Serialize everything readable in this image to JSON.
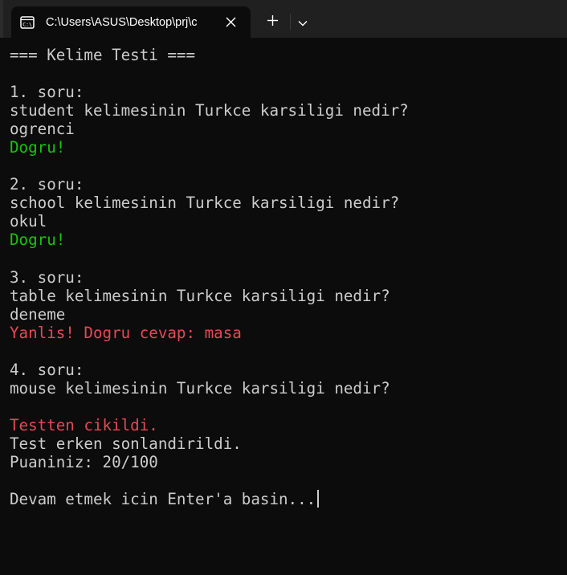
{
  "window": {
    "tab_title": "C:\\Users\\ASUS\\Desktop\\prj\\c",
    "icons": {
      "tab": "terminal-icon",
      "close": "close-icon",
      "new_tab": "plus-icon",
      "dropdown": "chevron-down-icon"
    }
  },
  "colors": {
    "background": "#0c0c0c",
    "titlebar": "#202020",
    "text": "#cccccc",
    "success": "#16c60c",
    "error": "#e74856"
  },
  "terminal": {
    "header": "=== Kelime Testi ===",
    "questions": [
      {
        "label": "1. soru:",
        "prompt": "student kelimesinin Turkce karsiligi nedir?",
        "answer": "ogrenci",
        "result": "Dogru!"
      },
      {
        "label": "2. soru:",
        "prompt": "school kelimesinin Turkce karsiligi nedir?",
        "answer": "okul",
        "result": "Dogru!"
      },
      {
        "label": "3. soru:",
        "prompt": "table kelimesinin Turkce karsiligi nedir?",
        "answer": "deneme",
        "result": "Yanlis! Dogru cevap: masa"
      },
      {
        "label": "4. soru:",
        "prompt": "mouse kelimesinin Turkce karsiligi nedir?"
      }
    ],
    "exit_message": "Testten cikildi.",
    "early_end": "Test erken sonlandirildi.",
    "score": "Puaniniz: 20/100",
    "continue_prompt": "Devam etmek icin Enter'a basin..."
  }
}
